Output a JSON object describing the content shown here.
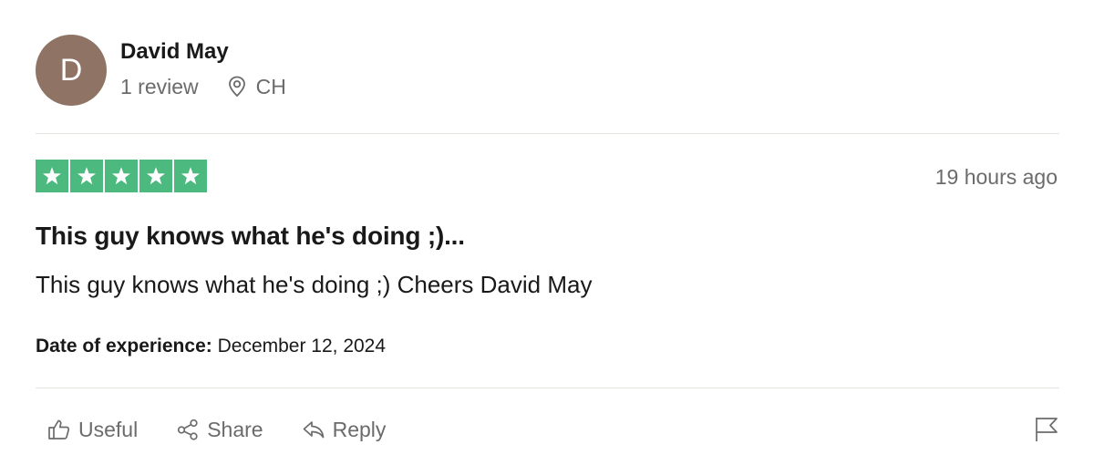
{
  "consumer": {
    "avatar_initial": "D",
    "name": "David May",
    "review_count": "1 review",
    "location": "CH",
    "location_icon": "location-pin-icon"
  },
  "review": {
    "rating": 5,
    "rating_max": 5,
    "star_color": "#4cb97f",
    "time_ago": "19 hours ago",
    "title": "This guy knows what he's doing ;)...",
    "text": "This guy knows what he's doing ;) Cheers David May",
    "experience_label": "Date of experience:",
    "experience_date": "December 12, 2024"
  },
  "actions": {
    "useful_label": "Useful",
    "useful_icon": "thumbs-up-icon",
    "share_label": "Share",
    "share_icon": "share-icon",
    "reply_label": "Reply",
    "reply_icon": "reply-icon",
    "report_icon": "flag-icon"
  }
}
